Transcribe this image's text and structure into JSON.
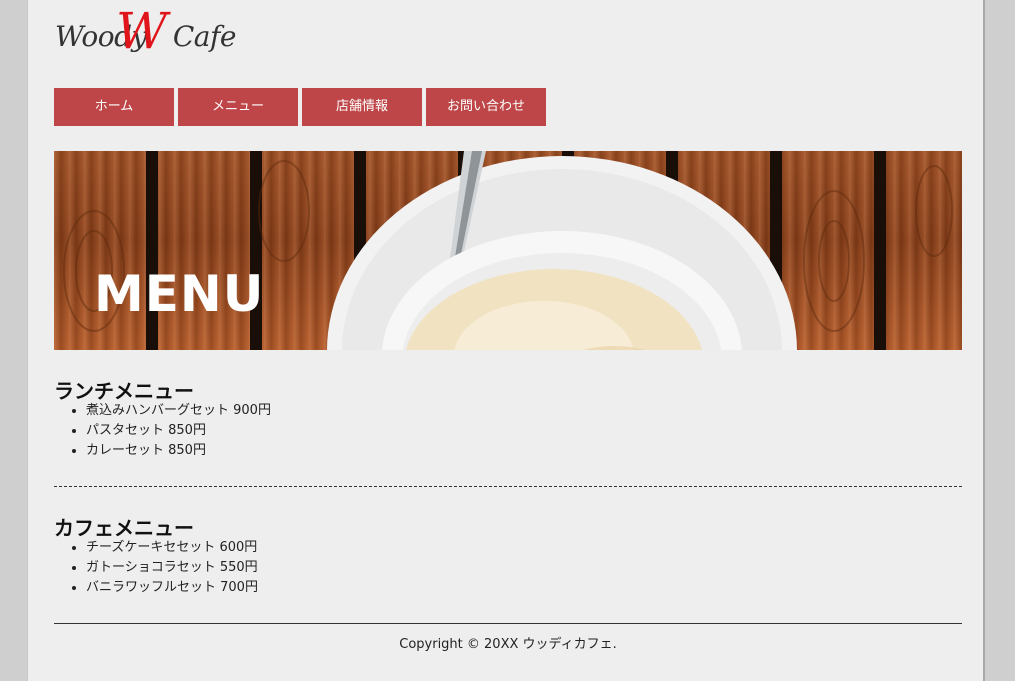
{
  "logo": {
    "left": "Woody",
    "w": "W",
    "right": "Cafe"
  },
  "nav": [
    {
      "label": "ホーム"
    },
    {
      "label": "メニュー"
    },
    {
      "label": "店舗情報"
    },
    {
      "label": "お問い合わせ"
    }
  ],
  "hero": {
    "title": "MENU"
  },
  "lunch": {
    "heading": "ランチメニュー",
    "items": [
      "煮込みハンバーグセット 900円",
      "パスタセット 850円",
      "カレーセット 850円"
    ]
  },
  "cafe": {
    "heading": "カフェメニュー",
    "items": [
      "チーズケーキセセット 600円",
      "ガトーショコラセット 550円",
      "バニラワッフルセット 700円"
    ]
  },
  "footer": {
    "copyright": "Copyright © 20XX ウッディカフェ."
  },
  "colors": {
    "nav_bg": "#bf4648",
    "logo_w": "#e0151b",
    "page_bg": "#eeeeee",
    "outer_bg": "#cfcfcf"
  }
}
